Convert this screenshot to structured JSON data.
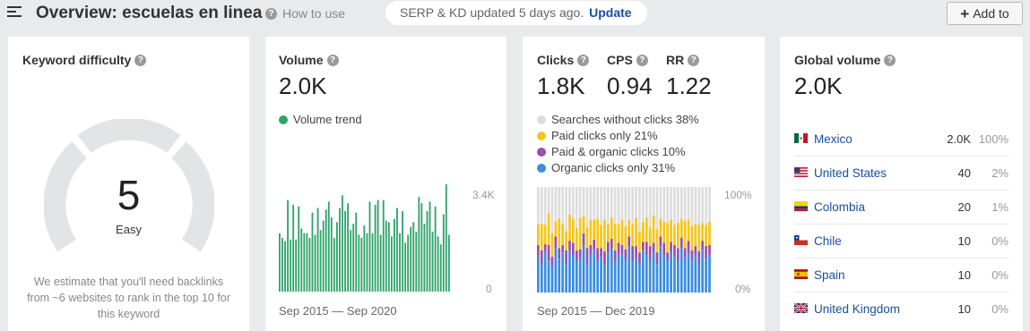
{
  "header": {
    "title": "Overview: escuelas en linea",
    "how_to": "How to use",
    "serp_status": "SERP & KD updated 5 days ago.",
    "update_label": "Update",
    "add_to_label": "Add to",
    "help_glyph": "?"
  },
  "keyword_difficulty": {
    "title": "Keyword difficulty",
    "value": "5",
    "score": 5,
    "label": "Easy",
    "description": "We estimate that you'll need backlinks from ~6 websites to rank in the top 10 for this keyword"
  },
  "volume": {
    "title": "Volume",
    "value": "2.0K",
    "legend": "Volume trend",
    "y_max_label": "3.4K",
    "y_min_label": "0",
    "date_range": "Sep 2015 — Sep 2020",
    "color": "#2ea36b"
  },
  "clicks": {
    "clicks_title": "Clicks",
    "clicks_value": "1.8K",
    "cps_title": "CPS",
    "cps_value": "0.94",
    "rr_title": "RR",
    "rr_value": "1.22",
    "legend": [
      {
        "label": "Searches without clicks 38%",
        "color": "#dddddd"
      },
      {
        "label": "Paid clicks only 21%",
        "color": "#f5c518"
      },
      {
        "label": "Paid & organic clicks 10%",
        "color": "#9b4fa6"
      },
      {
        "label": "Organic clicks only 31%",
        "color": "#3a8de0"
      }
    ],
    "y_max_label": "100%",
    "y_min_label": "0%",
    "date_range": "Sep 2015 — Dec 2019"
  },
  "global_volume": {
    "title": "Global volume",
    "value": "2.0K",
    "countries": [
      {
        "name": "Mexico",
        "volume": "2.0K",
        "share": "100%",
        "flag": "mexico-flag"
      },
      {
        "name": "United States",
        "volume": "40",
        "share": "2%",
        "flag": "us-flag"
      },
      {
        "name": "Colombia",
        "volume": "20",
        "share": "1%",
        "flag": "colombia-flag"
      },
      {
        "name": "Chile",
        "volume": "10",
        "share": "0%",
        "flag": "chile-flag"
      },
      {
        "name": "Spain",
        "volume": "10",
        "share": "0%",
        "flag": "spain-flag"
      },
      {
        "name": "United Kingdom",
        "volume": "10",
        "share": "0%",
        "flag": "uk-flag"
      }
    ]
  },
  "chart_data": [
    {
      "type": "bar",
      "ylim": [
        0,
        3400
      ],
      "y_tick_labels": [
        "0",
        "3.4K"
      ],
      "date_range": "Sep 2015 — Sep 2020",
      "series": [
        {
          "name": "Volume trend",
          "values": [
            1850,
            1700,
            1600,
            2900,
            1650,
            2750,
            1650,
            2700,
            2000,
            1850,
            1850,
            1700,
            2500,
            1800,
            2650,
            1950,
            2250,
            2600,
            2850,
            2350,
            1700,
            2200,
            2650,
            3050,
            2550,
            2800,
            1950,
            2150,
            2500,
            1800,
            1700,
            2100,
            1850,
            2850,
            1850,
            2750,
            2900,
            1800,
            2900,
            2250,
            2200,
            1750,
            2300,
            2650,
            1850,
            2550,
            1550,
            1800,
            2050,
            2200,
            1900,
            3000,
            2800,
            2150,
            2550,
            2850,
            1900,
            2700,
            1750,
            1500,
            2450,
            3450,
            1800
          ]
        }
      ]
    },
    {
      "type": "bar",
      "stacked": true,
      "ylim": [
        0,
        100
      ],
      "y_tick_labels": [
        "0%",
        "100%"
      ],
      "date_range": "Sep 2015 — Dec 2019",
      "series": [
        {
          "name": "Organic clicks only",
          "values": [
            35,
            28,
            38,
            30,
            25,
            42,
            32,
            38,
            27,
            40,
            35,
            30,
            33,
            45,
            28,
            36,
            40,
            30,
            34,
            26,
            38,
            42,
            29,
            35,
            37,
            31,
            44,
            30,
            33,
            28,
            40,
            36,
            31,
            38,
            27,
            43,
            35,
            30,
            39,
            34,
            29,
            42,
            33,
            37,
            30,
            36,
            28,
            40,
            32,
            35
          ]
        },
        {
          "name": "Paid & organic clicks",
          "values": [
            10,
            12,
            8,
            15,
            9,
            11,
            10,
            7,
            13,
            9,
            12,
            10,
            8,
            11,
            14,
            9,
            10,
            12,
            8,
            13,
            10,
            9,
            11,
            12,
            8,
            10,
            9,
            14,
            11,
            10,
            8,
            12,
            13,
            9,
            11,
            10,
            12,
            8,
            9,
            11,
            13,
            10,
            9,
            12,
            10,
            8,
            11,
            9,
            12,
            10
          ]
        },
        {
          "name": "Paid clicks only",
          "values": [
            20,
            25,
            18,
            30,
            22,
            15,
            28,
            20,
            18,
            25,
            23,
            21,
            30,
            16,
            20,
            24,
            19,
            28,
            22,
            30,
            17,
            20,
            25,
            18,
            24,
            22,
            16,
            21,
            27,
            20,
            19,
            23,
            18,
            26,
            22,
            17,
            20,
            28,
            21,
            19,
            24,
            18,
            26,
            20,
            23,
            21,
            25,
            17,
            20,
            22
          ]
        },
        {
          "name": "Searches without clicks",
          "values": [
            35,
            35,
            36,
            25,
            44,
            32,
            30,
            35,
            42,
            26,
            30,
            39,
            29,
            28,
            38,
            31,
            31,
            30,
            36,
            31,
            35,
            29,
            35,
            35,
            31,
            37,
            31,
            35,
            29,
            42,
            33,
            29,
            38,
            27,
            40,
            30,
            33,
            34,
            31,
            36,
            34,
            30,
            32,
            31,
            37,
            35,
            36,
            34,
            36,
            33
          ]
        }
      ]
    }
  ]
}
